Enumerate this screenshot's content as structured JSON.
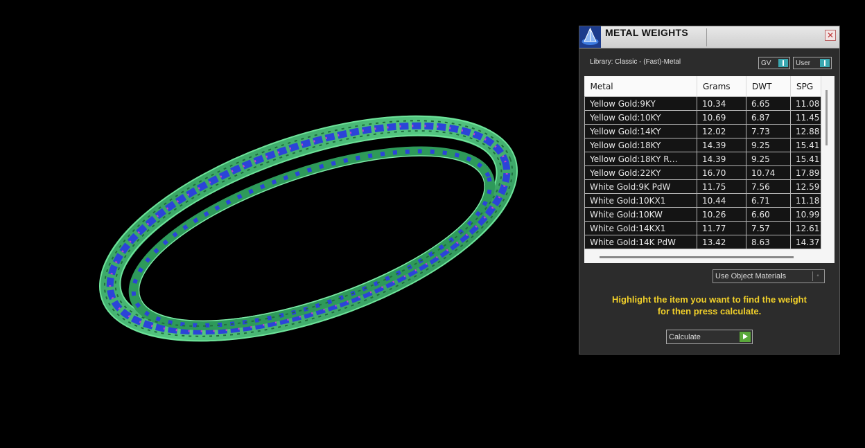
{
  "panel": {
    "title": "METAL WEIGHTS",
    "close_icon": "close-icon",
    "library_label": "Library: Classic - (Fast)-Metal",
    "toggles": {
      "gv_label": "GV",
      "user_label": "User"
    },
    "table": {
      "columns": [
        "Metal",
        "Grams",
        "DWT",
        "SPG"
      ],
      "rows": [
        [
          "Yellow Gold:9KY",
          "10.34",
          "6.65",
          "11.08"
        ],
        [
          "Yellow Gold:10KY",
          "10.69",
          "6.87",
          "11.45"
        ],
        [
          "Yellow Gold:14KY",
          "12.02",
          "7.73",
          "12.88"
        ],
        [
          "Yellow Gold:18KY",
          "14.39",
          "9.25",
          "15.41"
        ],
        [
          "Yellow Gold:18KY R…",
          "14.39",
          "9.25",
          "15.41"
        ],
        [
          "Yellow Gold:22KY",
          "16.70",
          "10.74",
          "17.89"
        ],
        [
          "White Gold:9K PdW",
          "11.75",
          "7.56",
          "12.59"
        ],
        [
          "White Gold:10KX1",
          "10.44",
          "6.71",
          "11.18"
        ],
        [
          "White Gold:10KW",
          "10.26",
          "6.60",
          "10.99"
        ],
        [
          "White Gold:14KX1",
          "11.77",
          "7.57",
          "12.61"
        ],
        [
          "White Gold:14K PdW",
          "13.42",
          "8.63",
          "14.37"
        ]
      ]
    },
    "material_select": "Use Object Materials",
    "hint_line1": "Highlight the item you want to find the weight",
    "hint_line2": "for then press calculate.",
    "calculate_label": "Calculate"
  },
  "colors": {
    "background": "#000000",
    "ring_metal": "#3fb06a",
    "gem_blue": "#2b44d8",
    "hint_text": "#f0cf2a",
    "toggle_accent": "#3aa7b0",
    "calculate_arrow": "#5aa83a"
  }
}
